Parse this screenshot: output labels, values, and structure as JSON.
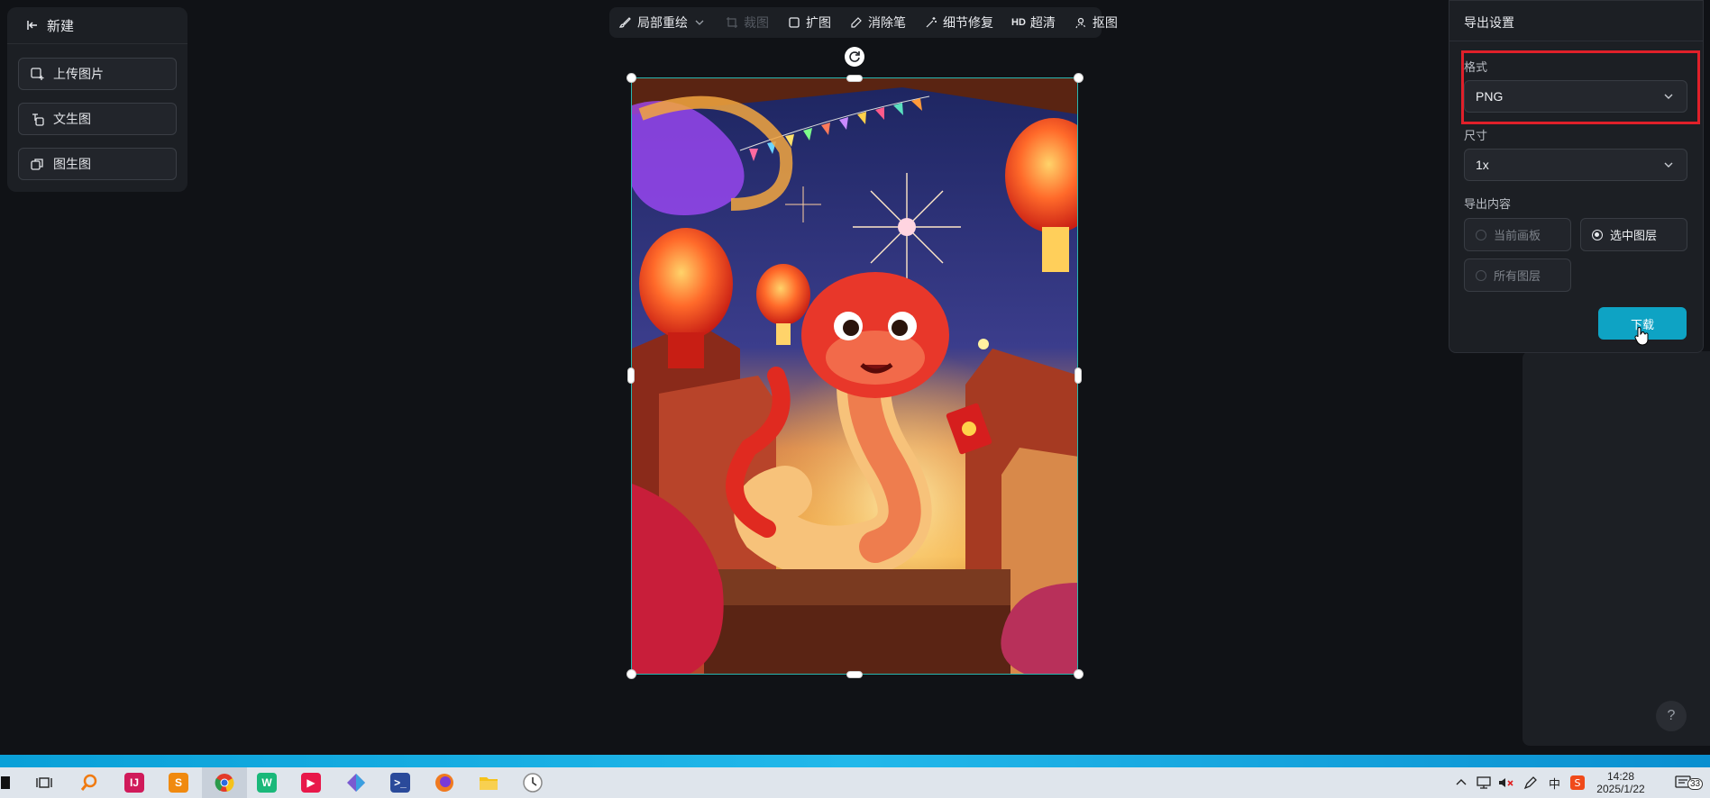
{
  "left_panel": {
    "new_label": "新建",
    "buttons": [
      {
        "label": "上传图片",
        "icon": "image-upload-icon"
      },
      {
        "label": "文生图",
        "icon": "text-to-image-icon"
      },
      {
        "label": "图生图",
        "icon": "image-to-image-icon"
      }
    ]
  },
  "toolbar": {
    "inpaint": "局部重绘",
    "crop": "裁图",
    "expand": "扩图",
    "eraser": "消除笔",
    "detail_fix": "细节修复",
    "hd_badge": "HD",
    "upscale": "超清",
    "cutout": "抠图"
  },
  "export": {
    "title": "导出设置",
    "format_label": "格式",
    "format_value": "PNG",
    "size_label": "尺寸",
    "size_value": "1x",
    "content_label": "导出内容",
    "options": [
      {
        "label": "当前画板",
        "selected": false
      },
      {
        "label": "选中图层",
        "selected": true
      },
      {
        "label": "所有图层",
        "selected": false
      }
    ],
    "download_label": "下载"
  },
  "help_label": "?",
  "taskbar": {
    "ime": "中",
    "time": "14:28",
    "date": "2025/1/22",
    "notification_count": "33"
  },
  "colors": {
    "accent": "#0ea3c4",
    "highlight": "#e0202a",
    "selection": "#2ab6b0"
  }
}
